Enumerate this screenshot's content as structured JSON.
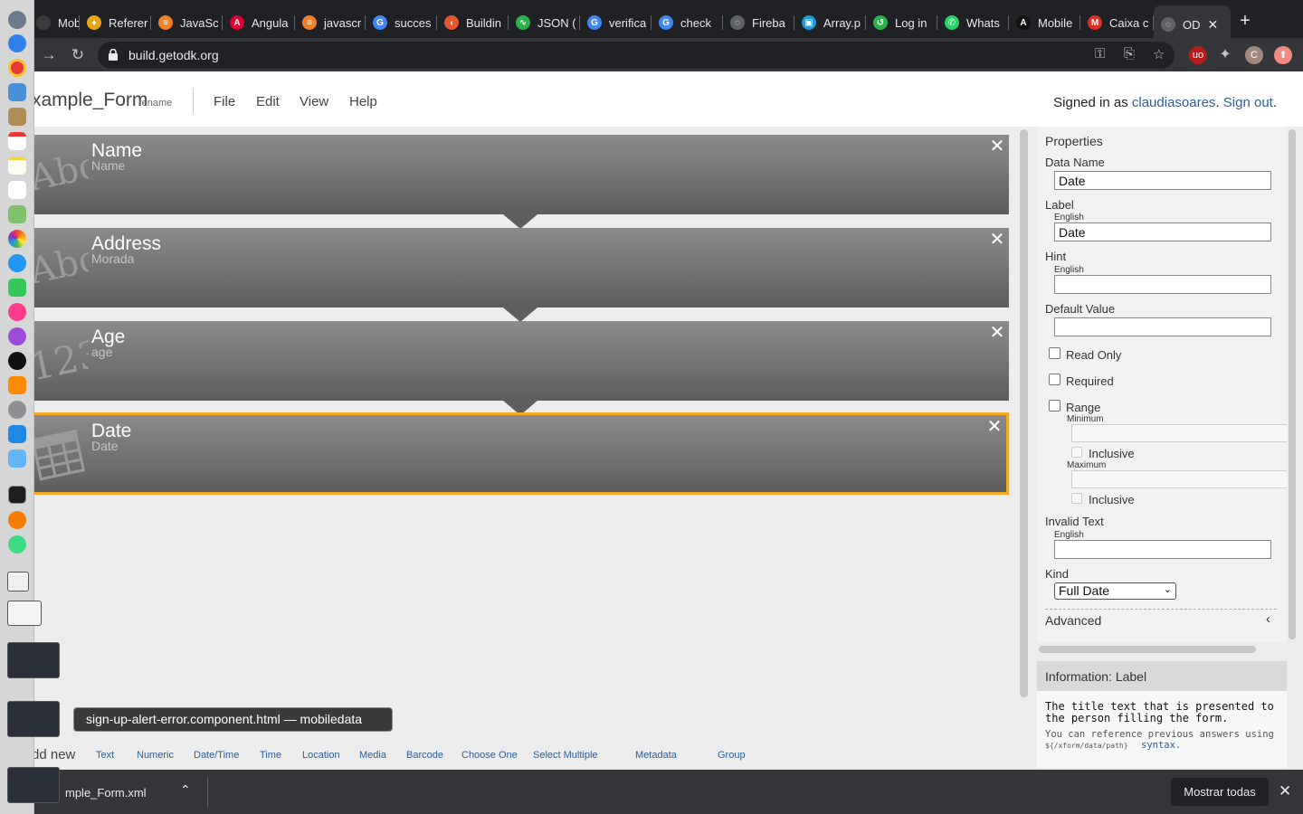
{
  "browser": {
    "tabs": [
      {
        "title": "Mobile",
        "color": "#3c3c3c",
        "glyph": ""
      },
      {
        "title": "Referer",
        "color": "#e8a317",
        "glyph": "♦"
      },
      {
        "title": "JavaSc",
        "color": "#f48024",
        "glyph": "≡"
      },
      {
        "title": "Angula",
        "color": "#dd0031",
        "glyph": "A"
      },
      {
        "title": "javascr",
        "color": "#f48024",
        "glyph": "≡"
      },
      {
        "title": "succes",
        "color": "#4285f4",
        "glyph": "G"
      },
      {
        "title": "Buildin",
        "color": "#e4572e",
        "glyph": "‹"
      },
      {
        "title": "JSON (",
        "color": "#2bb24c",
        "glyph": "∿"
      },
      {
        "title": "verifica",
        "color": "#4285f4",
        "glyph": "G"
      },
      {
        "title": "check",
        "color": "#4285f4",
        "glyph": "G"
      },
      {
        "title": "Fireba",
        "color": "#5f6368",
        "glyph": "◌"
      },
      {
        "title": "Array.p",
        "color": "#1a9bd7",
        "glyph": "▣"
      },
      {
        "title": "Log in",
        "color": "#2bb24c",
        "glyph": "↺"
      },
      {
        "title": "Whats",
        "color": "#25d366",
        "glyph": "✆"
      },
      {
        "title": "Mobile",
        "color": "#111111",
        "glyph": "A"
      },
      {
        "title": "Caixa c",
        "color": "#d93025",
        "glyph": "M"
      },
      {
        "title": "OD",
        "color": "#5f6368",
        "glyph": "◌"
      }
    ],
    "url": "build.getodk.org"
  },
  "app": {
    "form_title": "xample_Form",
    "rename": "rename",
    "menu": [
      "File",
      "Edit",
      "View",
      "Help"
    ],
    "signed_in_prefix": "Signed in as ",
    "username": "claudiasoares",
    "sign_out": "Sign out",
    "period": "."
  },
  "controls": [
    {
      "name": "Name",
      "sub": "Name",
      "icon": "abc",
      "glyph": "Abc"
    },
    {
      "name": "Address",
      "sub": "Morada",
      "icon": "abc",
      "glyph": "Abc"
    },
    {
      "name": "Age",
      "sub": "age",
      "icon": "number",
      "glyph": "123"
    },
    {
      "name": "Date",
      "sub": "Date",
      "icon": "date",
      "glyph": ""
    }
  ],
  "palette": {
    "label": "dd new",
    "items": [
      "Text",
      "Numeric",
      "Date/Time",
      "Time",
      "Location",
      "Media",
      "Barcode",
      "Choose One",
      "Select Multiple",
      "Metadata",
      "Group"
    ]
  },
  "properties": {
    "title": "Properties",
    "data_name_label": "Data Name",
    "data_name_value": "Date",
    "label_label": "Label",
    "label_lang": "English",
    "label_value": "Date",
    "hint_label": "Hint",
    "hint_lang": "English",
    "hint_value": "",
    "default_label": "Default Value",
    "default_value": "",
    "read_only": "Read Only",
    "required": "Required",
    "range": "Range",
    "minimum": "Minimum",
    "inclusive": "Inclusive",
    "maximum": "Maximum",
    "invalid_label": "Invalid Text",
    "invalid_lang": "English",
    "kind_label": "Kind",
    "kind_value": "Full Date",
    "advanced": "Advanced"
  },
  "info": {
    "title": "Information: Label",
    "text": "The title text that is presented to the person filling the form.",
    "note": "You can reference previous answers using",
    "code": "${/xform/data/path}",
    "syntax": "syntax."
  },
  "tooltip": "sign-up-alert-error.component.html — mobiledata",
  "downloads": {
    "file": "mple_Form.xml",
    "show_all": "Mostrar todas"
  }
}
